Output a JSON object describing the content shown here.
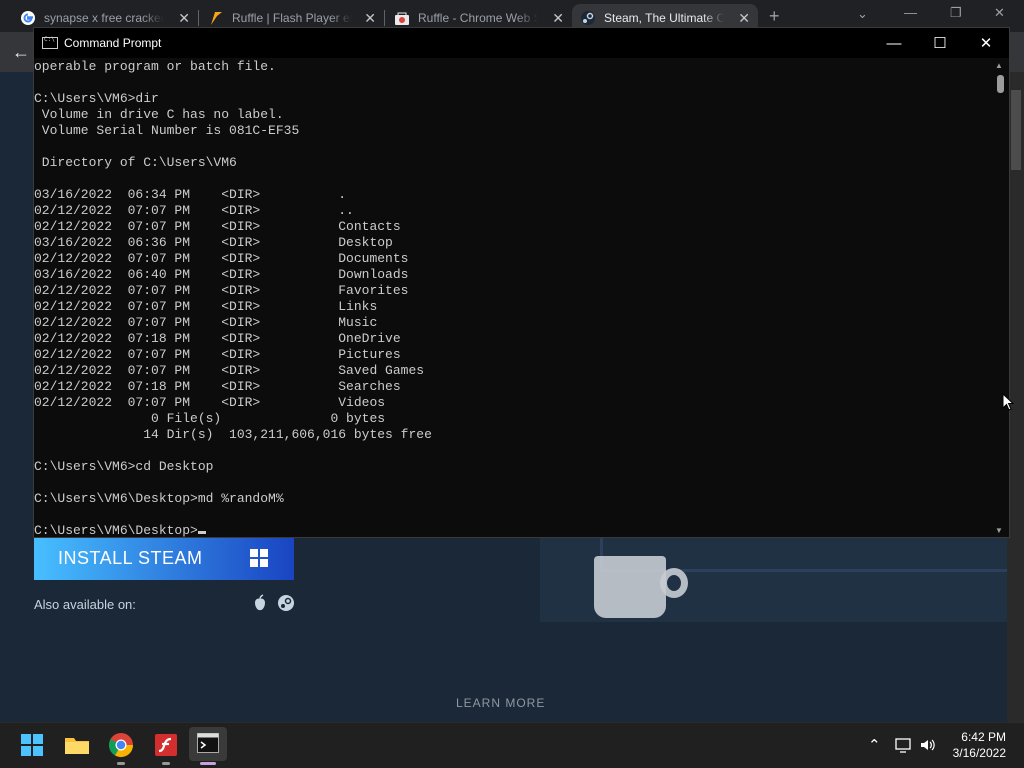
{
  "browser": {
    "tabs": [
      {
        "title": "synapse x free cracked",
        "icon": "google-icon"
      },
      {
        "title": "Ruffle | Flash Player em",
        "icon": "ruffle-icon"
      },
      {
        "title": "Ruffle - Chrome Web S",
        "icon": "chrome-web-store-icon"
      },
      {
        "title": "Steam, The Ultimate O",
        "icon": "steam-icon"
      }
    ],
    "new_tab": "+",
    "close_glyph": "✕"
  },
  "steam_page": {
    "install_button": "INSTALL STEAM",
    "also_available": "Also available on:",
    "learn_more": "LEARN MORE",
    "accent_gradient": [
      "#47bfff",
      "#1a44c2"
    ]
  },
  "cmd": {
    "title": "Command Prompt",
    "lines": [
      "operable program or batch file.",
      "",
      "C:\\Users\\VM6>dir",
      " Volume in drive C has no label.",
      " Volume Serial Number is 081C-EF35",
      "",
      " Directory of C:\\Users\\VM6",
      "",
      "03/16/2022  06:34 PM    <DIR>          .",
      "02/12/2022  07:07 PM    <DIR>          ..",
      "02/12/2022  07:07 PM    <DIR>          Contacts",
      "03/16/2022  06:36 PM    <DIR>          Desktop",
      "02/12/2022  07:07 PM    <DIR>          Documents",
      "03/16/2022  06:40 PM    <DIR>          Downloads",
      "02/12/2022  07:07 PM    <DIR>          Favorites",
      "02/12/2022  07:07 PM    <DIR>          Links",
      "02/12/2022  07:07 PM    <DIR>          Music",
      "02/12/2022  07:18 PM    <DIR>          OneDrive",
      "02/12/2022  07:07 PM    <DIR>          Pictures",
      "02/12/2022  07:07 PM    <DIR>          Saved Games",
      "02/12/2022  07:18 PM    <DIR>          Searches",
      "02/12/2022  07:07 PM    <DIR>          Videos",
      "               0 File(s)              0 bytes",
      "              14 Dir(s)  103,211,606,016 bytes free",
      "",
      "C:\\Users\\VM6>cd Desktop",
      "",
      "C:\\Users\\VM6\\Desktop>md %randoM%",
      ""
    ],
    "prompt": "C:\\Users\\VM6\\Desktop>"
  },
  "taskbar": {
    "apps": [
      "start-icon",
      "file-explorer-icon",
      "chrome-icon",
      "flash-player-icon",
      "command-prompt-icon"
    ],
    "time": "6:42 PM",
    "date": "3/16/2022"
  }
}
